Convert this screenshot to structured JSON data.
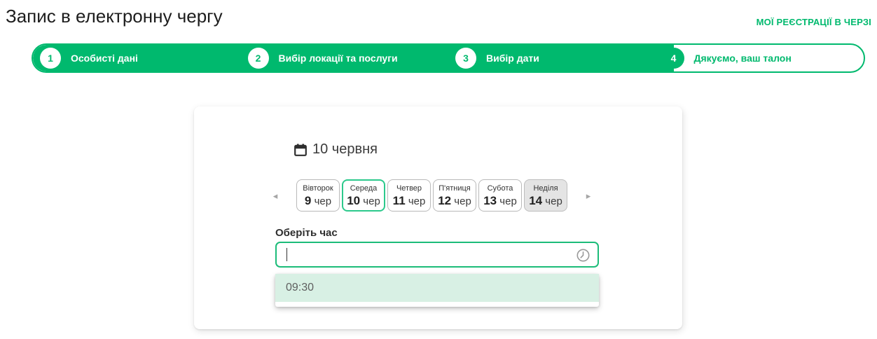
{
  "colors": {
    "accent": "#00b96e",
    "selected_border": "#2cc98c",
    "input_border": "#1cbc79",
    "option_bg": "#d8f0e4",
    "disabled_bg": "#e4e4e4"
  },
  "header": {
    "title": "Запис в електронну чергу",
    "my_registrations_link": "МОЇ РЕЄСТРАЦІЇ В ЧЕРЗІ"
  },
  "stepper": {
    "steps": [
      {
        "number": "1",
        "label": "Особисті дані",
        "state": "done"
      },
      {
        "number": "2",
        "label": "Вибір локації та послуги",
        "state": "done"
      },
      {
        "number": "3",
        "label": "Вибір дати",
        "state": "done"
      },
      {
        "number": "4",
        "label": "Дякуємо, ваш талон",
        "state": "current"
      }
    ]
  },
  "card": {
    "selected_date_heading": "10 червня",
    "day_picker": {
      "prev_arrow": "◂",
      "next_arrow": "▸",
      "days": [
        {
          "name": "Вівторок",
          "date": "9",
          "month": "чер",
          "state": "normal"
        },
        {
          "name": "Середа",
          "date": "10",
          "month": "чер",
          "state": "selected"
        },
        {
          "name": "Четвер",
          "date": "11",
          "month": "чер",
          "state": "normal"
        },
        {
          "name": "П'ятниця",
          "date": "12",
          "month": "чер",
          "state": "normal"
        },
        {
          "name": "Субота",
          "date": "13",
          "month": "чер",
          "state": "normal"
        },
        {
          "name": "Неділя",
          "date": "14",
          "month": "чер",
          "state": "disabled"
        }
      ]
    },
    "time_section": {
      "label": "Оберіть час",
      "input_value": "",
      "options": [
        "09:30"
      ]
    }
  },
  "icons": {
    "calendar": "calendar-icon",
    "clock": "clock-icon"
  }
}
